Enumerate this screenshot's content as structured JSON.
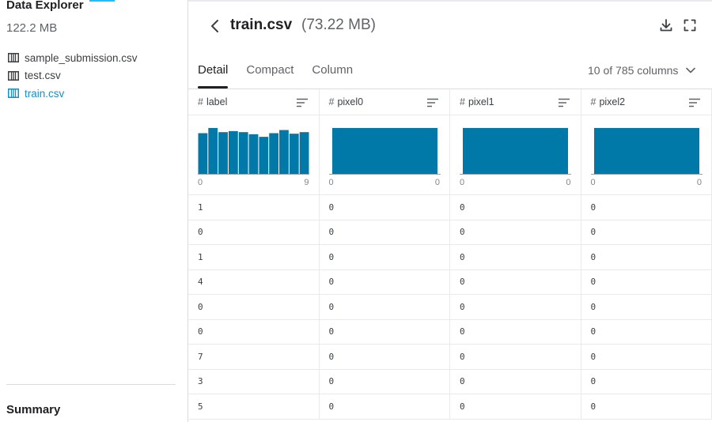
{
  "sidebar": {
    "title": "Data Explorer",
    "size": "122.2 MB",
    "files": [
      {
        "name": "sample_submission.csv",
        "active": false
      },
      {
        "name": "test.csv",
        "active": false
      },
      {
        "name": "train.csv",
        "active": true
      }
    ],
    "summary_label": "Summary"
  },
  "header": {
    "file_name": "train.csv",
    "file_size": "(73.22 MB)"
  },
  "tabs": [
    "Detail",
    "Compact",
    "Column"
  ],
  "column_selector": "10 of 785 columns",
  "colors": {
    "bar": "#0079a8",
    "active_file": "#1a8fc4",
    "accent": "#20beff"
  },
  "columns": [
    {
      "name": "label",
      "min": "0",
      "max": "9",
      "hist": [
        0.78,
        0.88,
        0.8,
        0.82,
        0.8,
        0.76,
        0.71,
        0.78,
        0.84,
        0.77,
        0.8
      ]
    },
    {
      "name": "pixel0",
      "min": "0",
      "max": "0",
      "hist": [
        0.88
      ]
    },
    {
      "name": "pixel1",
      "min": "0",
      "max": "0",
      "hist": [
        0.88
      ]
    },
    {
      "name": "pixel2",
      "min": "0",
      "max": "0",
      "hist": [
        0.88
      ]
    }
  ],
  "rows": [
    [
      "1",
      "0",
      "0",
      "0"
    ],
    [
      "0",
      "0",
      "0",
      "0"
    ],
    [
      "1",
      "0",
      "0",
      "0"
    ],
    [
      "4",
      "0",
      "0",
      "0"
    ],
    [
      "0",
      "0",
      "0",
      "0"
    ],
    [
      "0",
      "0",
      "0",
      "0"
    ],
    [
      "7",
      "0",
      "0",
      "0"
    ],
    [
      "3",
      "0",
      "0",
      "0"
    ],
    [
      "5",
      "0",
      "0",
      "0"
    ]
  ]
}
